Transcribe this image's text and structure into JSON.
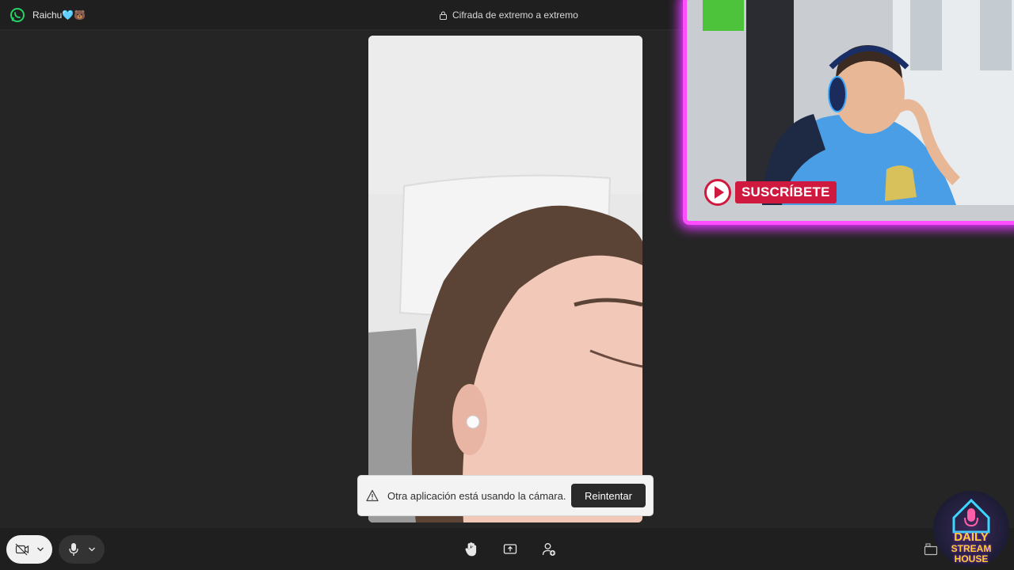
{
  "titlebar": {
    "app_icon": "whatsapp-icon",
    "contact_name": "Raichu🩵🐻",
    "encryption_label": "Cifrada de extremo a extremo"
  },
  "overlay": {
    "subscribe_label": "SUSCRÍBETE",
    "watermark_line1": "DAILY",
    "watermark_line2": "STREAM",
    "watermark_line3": "HOUSE"
  },
  "notification": {
    "icon": "warning-icon",
    "message": "Otra aplicación está usando la cámara.",
    "retry_label": "Reintentar"
  },
  "controls": {
    "camera_icon": "camera-off-icon",
    "mic_icon": "microphone-icon",
    "raise_hand_icon": "raise-hand-icon",
    "share_screen_icon": "share-screen-icon",
    "add_participant_icon": "add-participant-icon",
    "layout_icon": "layout-icon"
  },
  "colors": {
    "accent_whatsapp": "#25D366",
    "neon_frame": "#ff4dff",
    "subscribe_red": "#d0193e"
  }
}
